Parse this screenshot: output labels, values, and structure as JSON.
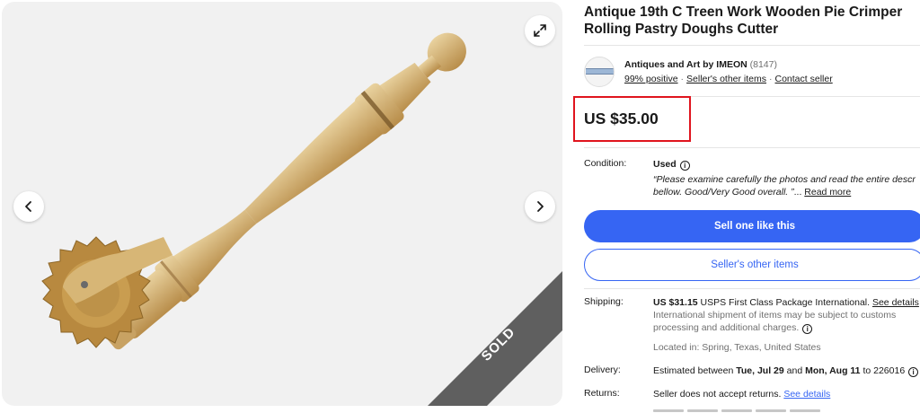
{
  "gallery": {
    "sold_label": "SOLD",
    "expand_icon": "expand-icon",
    "prev_icon": "chevron-left-icon",
    "next_icon": "chevron-right-icon"
  },
  "listing": {
    "title_line1": "Antique 19th C Treen Work Wooden Pie Crimper",
    "title_line2": "Rolling Pastry Doughs Cutter"
  },
  "seller": {
    "name": "Antiques and Art by IMEON",
    "feedback_count": "(8147)",
    "positive": "99% positive",
    "other_items_link": "Seller's other items",
    "contact_link": "Contact seller"
  },
  "price": {
    "value": "US $35.00",
    "highlight_color": "#e0141e"
  },
  "condition": {
    "label": "Condition:",
    "value": "Used",
    "desc_line1": "“Please examine carefully the photos and read the entire descr",
    "desc_line2": "bellow. Good/Very Good overall. ”",
    "ellipsis": "...",
    "read_more": "Read more"
  },
  "actions": {
    "sell_one": "Sell one like this",
    "sellers_other_items": "Seller's other items",
    "primary_color": "#3665f3"
  },
  "shipping": {
    "label": "Shipping:",
    "cost": "US $31.15",
    "method": " USPS First Class Package International. ",
    "details_link": "See details",
    "note_line1": "International shipment of items may be subject to customs",
    "note_line2": "processing and additional charges.",
    "location": "Located in: Spring, Texas, United States"
  },
  "delivery": {
    "label": "Delivery:",
    "prefix": "Estimated between ",
    "date_start": "Tue, Jul 29",
    "and": " and ",
    "date_end": "Mon, Aug 11",
    "suffix": " to 226016"
  },
  "returns": {
    "label": "Returns:",
    "text": "Seller does not accept returns. ",
    "details_link": "See details"
  }
}
